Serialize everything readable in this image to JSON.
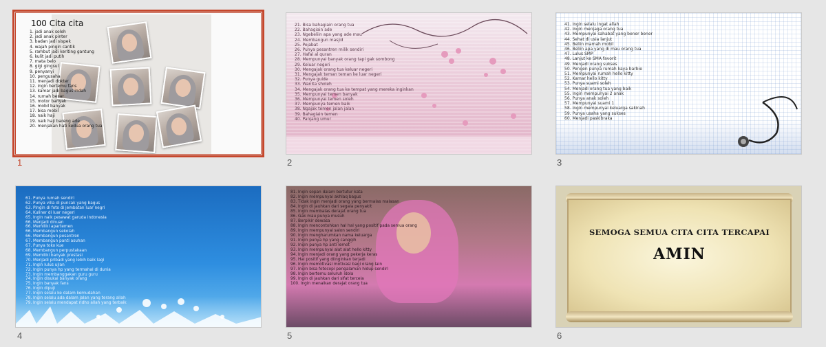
{
  "slide_numbers": [
    "1",
    "2",
    "3",
    "4",
    "5",
    "6"
  ],
  "slide1": {
    "title": "100 Cita cita",
    "lines": [
      "1. jadi anak soleh",
      "2. jadi anak pinter",
      "3. badan jadi sispek",
      "4. wajah pingin cantik",
      "5. rambut jadi keriting gantung",
      "6. kulit jadi putih",
      "7. mata belo",
      "8. gigi gingsul",
      "9. penyanyi",
      "10. pengusaha",
      "11. menjadi dokter",
      "12. ingin bertemu fans",
      "13. kamar jadi bagus indah",
      "14. rumah besar",
      "15. motor banyak",
      "16. mobil banyak",
      "17. bisa mobil",
      "18. naik haji",
      "19. naik haji bareng ade",
      "20. menjakan hati kedua orang tua"
    ]
  },
  "slide2": {
    "lines": [
      "21. Bisa bahagiain orang tua",
      "22. Bahagiain ade",
      "23. Ngebeliin apa yang ade mau",
      "24. Membangun masjid",
      "25. Pejabat",
      "26. Punya pesantren milik sendiri",
      "27. Hafal al quran",
      "28. Mempunyai banyak orang tapi gak sombong",
      "29. Keluar negeri",
      "30. Mengajak orang tua keluar negeri",
      "31. Mengajak teman teman ke luar negeri",
      "32. Punya guide",
      "33. Wanita sholeh",
      "34. Mengajak orang tua ke tempat yang mereka inginkan",
      "35. Mempunyai temen banyak",
      "36. Mempunyai temen soleh",
      "37. Mempunya temen baik",
      "38. Ngajak temen jalan jalan",
      "39. Bahagiain temen",
      "40. Panjang umur"
    ]
  },
  "slide3": {
    "lines": [
      "41. Ingin selalu ingat allah",
      "42. Ingin menjaga orang tua",
      "43. Mempunyai sahabat yang bener bener",
      "44. Sehat di usia lanjut",
      "45. Beliin mamah mobil",
      "46. Beliin apa yang di mau orang tua",
      "47. Lulus SMP",
      "48. Lanjut ke SMA favorit",
      "49. Menjadi orang sukses",
      "50. Pengen punya rumah kaya barbie",
      "51. Mempunyai rumah hello kitty",
      "52. Kamar hello kitty",
      "53. Punya suami soleh",
      "54. Menjadi orang tua yang baik",
      "55. Ingin mempunyai 2 anak",
      "56. Punya anak soleh",
      "57. Mempunyai suami 1",
      "58. Ingin mempunyai keluarga sakinah",
      "59. Punya usaha yang sukses",
      "60. Menjadi paskibraka"
    ]
  },
  "slide4": {
    "lines": [
      "61. Punya rumah sendiri",
      "62. Punya villa di puncak yang bagus",
      "63. Pingin di foto di jembatan luar negri",
      "64. Kuliner di luar negeri",
      "65. Ingin naik pesawat garuda indonesia",
      "66. Menjadi dinuan",
      "66. Memiliki apartemen",
      "66. Membangun sekolah",
      "66. Membangun pesantren",
      "67. Membangun panti asuhan",
      "67. Punya toko kue",
      "68. Membangun perpustakaan",
      "69. Memiliki banyak prestasi",
      "70. Menjadi pribadi yang lebih baik lagi",
      "71. Ingin lulus ujian",
      "72. Ingin punya hp yang termahal di dunia",
      "73. Ingin membanggakan guru guru",
      "74. Ingin disukai banyak orang",
      "75. Ingin banyak fans",
      "76. Ingin dipuji",
      "77. Ingin selalu ke dalam kemudahan",
      "78. Ingin selalu ada dalam jalan yang terang allah",
      "79. Ingin selalu mendapat ridho allah yang terbaik"
    ]
  },
  "slide5": {
    "lines": [
      "81. Ingin sopan dalam bertutur kata",
      "82. Ingin mempunyai akhlaq bagus",
      "83. Tidak ingin menjadi orang yang bermalas malasan",
      "84. Ingin di jauhkan dari segala penyakit",
      "85. Ingin membalas derajat orang tua",
      "86. Gak mau punya musuh",
      "87. Berpikir dewasa",
      "88. Ingin mencontohkan hal hal yang positif pada semua orang",
      "89. Ingin mempunyai salon sendiri",
      "90. Ingin mengharumkan nama keluarga",
      "91. Ingin punya hp yang canggih",
      "92. Ingin punya hp anti lemot",
      "93. Ingin mempunyai alat alat hello kitty",
      "94. Ingin menjadi orang yang pekerja keras",
      "95. Hal positif yang diinginkan terjadi",
      "96. Ingin memotivasi motivasi bagi orang lain",
      "97. Ingin bisa fotocopi pengalaman hidup sendiri",
      "98. Ingin bertemu seluruh idola",
      "99. Ingin di jauhkan dari sifat tercela",
      "100. Ingin menaikan derajat orang tua"
    ]
  },
  "slide6": {
    "line1": "SEMOGA SEMUA CITA CITA TERCAPAI",
    "line2": "AMIN"
  },
  "colors": {
    "selection": "#c5462b",
    "background": "#e6e6e6"
  }
}
